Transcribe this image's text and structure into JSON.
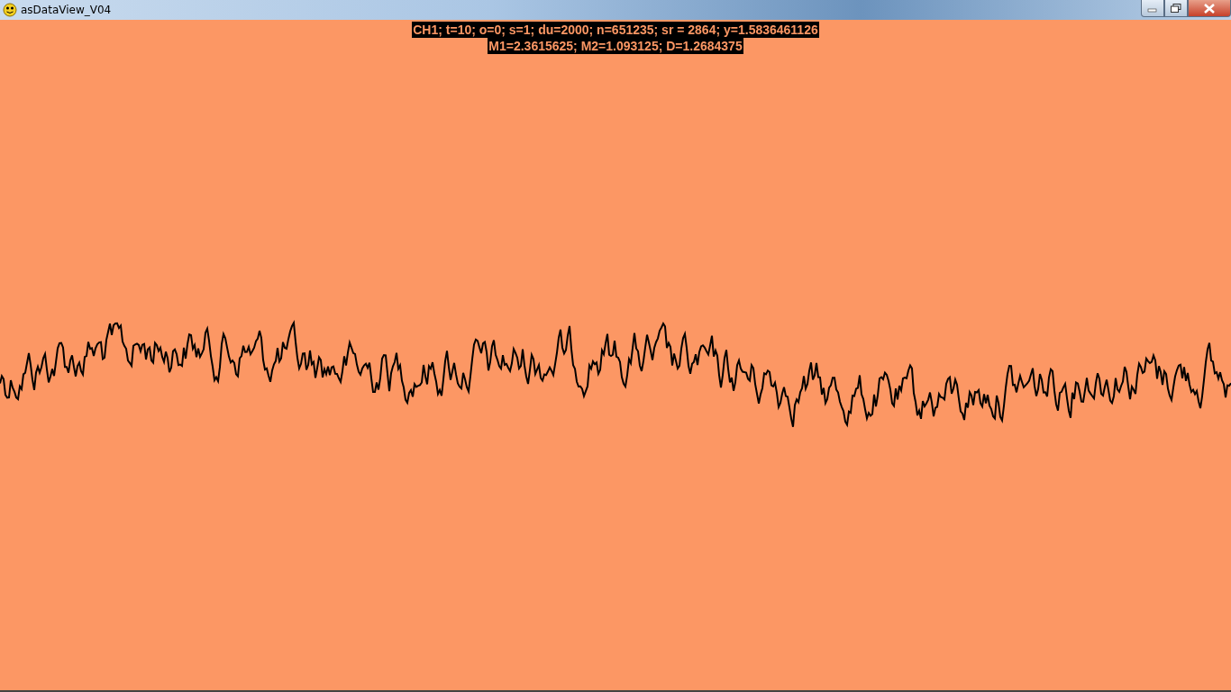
{
  "window": {
    "title": "asDataView_V04"
  },
  "readout": {
    "lines": [
      "CH1; t=10; o=0; s=1; du=2000; n=651235; sr = 2864; y=1.5836461126",
      "M1=2.3615625; M2=1.093125; D=1.2684375"
    ]
  }
}
